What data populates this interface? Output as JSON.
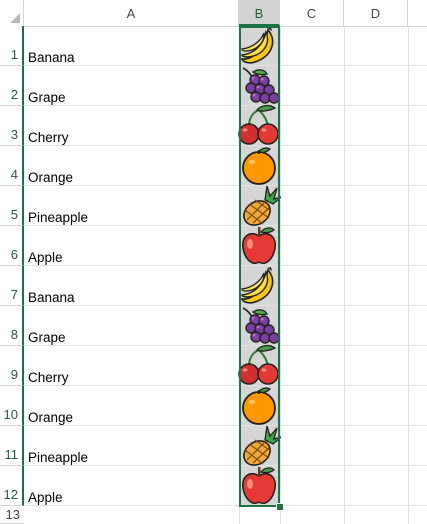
{
  "columns": [
    "A",
    "B",
    "C",
    "D"
  ],
  "selected_column": "B",
  "row_numbers": [
    "1",
    "2",
    "3",
    "4",
    "5",
    "6",
    "7",
    "8",
    "9",
    "10",
    "11",
    "12",
    "13"
  ],
  "rows": [
    {
      "name": "Banana",
      "icon": "banana-icon"
    },
    {
      "name": "Grape",
      "icon": "grape-icon"
    },
    {
      "name": "Cherry",
      "icon": "cherry-icon"
    },
    {
      "name": "Orange",
      "icon": "orange-icon"
    },
    {
      "name": "Pineapple",
      "icon": "pineapple-icon"
    },
    {
      "name": "Apple",
      "icon": "apple-icon"
    },
    {
      "name": "Banana",
      "icon": "banana-icon"
    },
    {
      "name": "Grape",
      "icon": "grape-icon"
    },
    {
      "name": "Cherry",
      "icon": "cherry-icon"
    },
    {
      "name": "Orange",
      "icon": "orange-icon"
    },
    {
      "name": "Pineapple",
      "icon": "pineapple-icon"
    },
    {
      "name": "Apple",
      "icon": "apple-icon"
    }
  ],
  "colors": {
    "selection": "#1e7145",
    "selected_fill": "#d6d6d6"
  }
}
